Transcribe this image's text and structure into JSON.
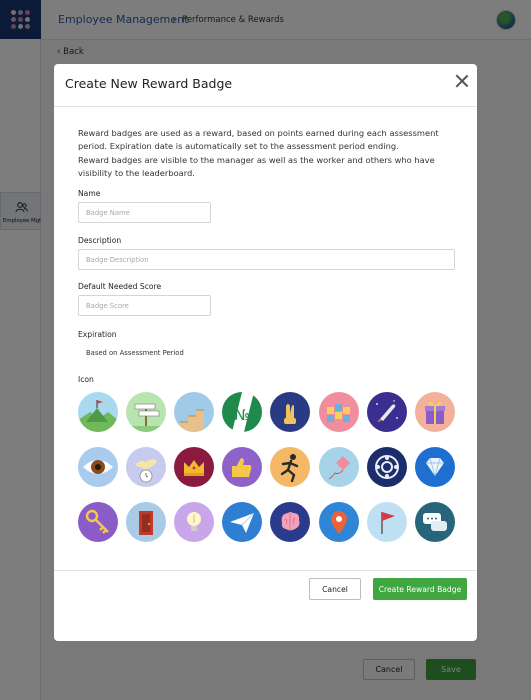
{
  "app": {
    "breadcrumb_main": "Employee Management",
    "breadcrumb_separator": "›",
    "breadcrumb_current": "Performance & Rewards",
    "back_label": "Back",
    "sidebar_items": [
      {
        "label": "Employee Mgt",
        "icon": "users-icon"
      }
    ],
    "footer_cancel": "Cancel",
    "footer_save": "Save"
  },
  "modal": {
    "title": "Create New Reward Badge",
    "description_lines": [
      "Reward badges are used as a reward, based on points earned during each assessment",
      "period. Expiration date is automatically set to the assessment period ending.",
      "Reward badges are visible to the manager as well as the worker and others who have",
      "visibility to the leaderboard."
    ],
    "name": {
      "label": "Name",
      "placeholder": "Badge Name",
      "value": ""
    },
    "description": {
      "label": "Description",
      "placeholder": "Badge Description",
      "value": ""
    },
    "score": {
      "label": "Default Needed Score",
      "placeholder": "Badge Score",
      "value": ""
    },
    "expiration": {
      "label": "Expiration",
      "value": "Based on Assessment Period"
    },
    "icon_section_label": "Icon",
    "icons": [
      "mountain-flag-icon",
      "signpost-icon",
      "stairs-icon",
      "number-one-icon",
      "fingers-crossed-icon",
      "achievement-bars-icon",
      "rocket-icon",
      "gift-icon",
      "eye-icon",
      "bird-clock-icon",
      "crown-icon",
      "thumbs-up-icon",
      "runner-icon",
      "kite-icon",
      "gear-ring-icon",
      "diamond-icon",
      "key-icon",
      "door-icon",
      "lightbulb-icon",
      "paper-plane-icon",
      "brain-icon",
      "map-pin-icon",
      "flag-icon",
      "chat-bubbles-icon"
    ],
    "cancel_label": "Cancel",
    "submit_label": "Create Reward Badge"
  },
  "colors": {
    "logo_navy": "#16366e",
    "primary_green": "#3fa640",
    "link_blue": "#2f5aa6"
  }
}
